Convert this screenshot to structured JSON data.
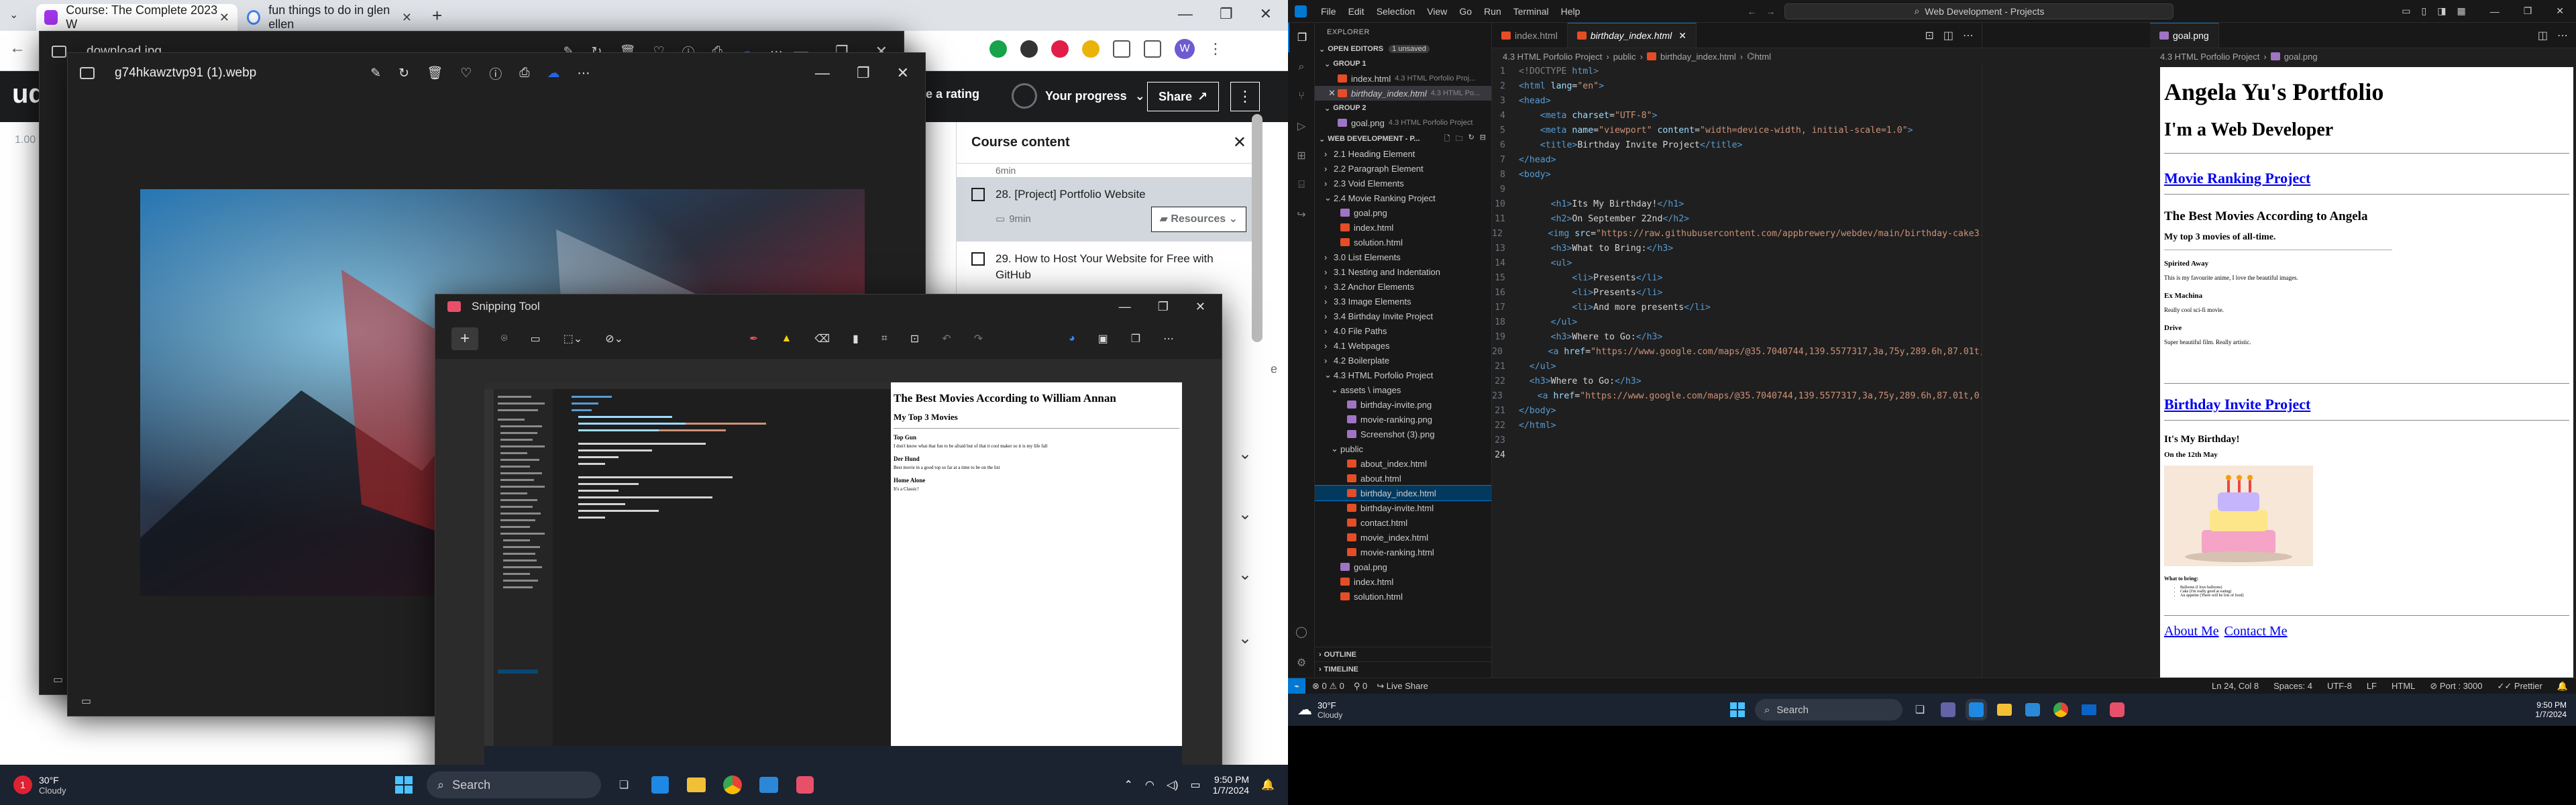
{
  "browser": {
    "tabs": [
      {
        "title": "Course: The Complete 2023 W"
      },
      {
        "title": "fun things to do in glen ellen"
      }
    ],
    "udemy": {
      "logo_fragment": "ud",
      "rating_text": "e a rating",
      "progress_label": "Your progress",
      "share_label": "Share",
      "zoom_fragment": "1.00"
    },
    "course_content": {
      "title": "Course content",
      "partial_top": "6min",
      "items": [
        {
          "title": "28. [Project] Portfolio Website",
          "duration": "9min",
          "resources": "Resources"
        },
        {
          "title": "29. How to Host Your Website for Free with GitHub",
          "duration": "",
          "resources": ""
        }
      ],
      "side_fragment": "e"
    }
  },
  "viewer_back": {
    "filename": "download.jpg"
  },
  "viewer_front": {
    "filename": "g74hkawztvp91 (1).webp"
  },
  "snipping_tool": {
    "title": "Snipping Tool",
    "mini": {
      "preview_h1": "The Best Movies According to William Annan",
      "preview_h2": "My Top 3 Movies",
      "entries": [
        {
          "title": "Top Gun",
          "desc": "I don't know what that fun to be afraid but of that it cool maker so it is my life fall"
        },
        {
          "title": "Der Hund",
          "desc": "Best movie in a good top so far at a time to be on the list"
        },
        {
          "title": "Home Alone",
          "desc": "It's a Classic!"
        }
      ]
    }
  },
  "taskbar_left": {
    "weather_temp": "30°F",
    "weather_text": "Cloudy",
    "search": "Search",
    "time": "9:50 PM",
    "date": "1/7/2024"
  },
  "vscode": {
    "menu": [
      "File",
      "Edit",
      "Selection",
      "View",
      "Go",
      "Run",
      "Terminal",
      "Help"
    ],
    "search": "Web Development - Projects",
    "explorer_title": "EXPLORER",
    "open_editors": "OPEN EDITORS",
    "unsaved": "1 unsaved",
    "group1": "GROUP 1",
    "group2": "GROUP 2",
    "open_files": [
      {
        "name": "index.html",
        "path": "4.3 HTML Porfolio Proj..."
      },
      {
        "name": "birthday_index.html",
        "path": "4.3 HTML Po..."
      },
      {
        "name": "goal.png",
        "path": "4.3 HTML Porfolio Project"
      }
    ],
    "workspace": "WEB DEVELOPMENT - P...",
    "tree": [
      {
        "label": "2.1 Heading Element",
        "kind": "folder",
        "depth": 1
      },
      {
        "label": "2.2 Paragraph Element",
        "kind": "folder",
        "depth": 1
      },
      {
        "label": "2.3 Void Elements",
        "kind": "folder",
        "depth": 1
      },
      {
        "label": "2.4 Movie Ranking Project",
        "kind": "folder-open",
        "depth": 1
      },
      {
        "label": "goal.png",
        "kind": "img",
        "depth": 2
      },
      {
        "label": "index.html",
        "kind": "html",
        "depth": 2
      },
      {
        "label": "solution.html",
        "kind": "html",
        "depth": 2
      },
      {
        "label": "3.0 List Elements",
        "kind": "folder",
        "depth": 1
      },
      {
        "label": "3.1 Nesting and Indentation",
        "kind": "folder",
        "depth": 1
      },
      {
        "label": "3.2 Anchor Elements",
        "kind": "folder",
        "depth": 1
      },
      {
        "label": "3.3 Image Elements",
        "kind": "folder",
        "depth": 1
      },
      {
        "label": "3.4 Birthday Invite Project",
        "kind": "folder",
        "depth": 1
      },
      {
        "label": "4.0 File Paths",
        "kind": "folder",
        "depth": 1
      },
      {
        "label": "4.1 Webpages",
        "kind": "folder",
        "depth": 1
      },
      {
        "label": "4.2 Boilerplate",
        "kind": "folder",
        "depth": 1
      },
      {
        "label": "4.3 HTML Porfolio Project",
        "kind": "folder-open",
        "depth": 1
      },
      {
        "label": "assets \\ images",
        "kind": "folder-open",
        "depth": 2
      },
      {
        "label": "birthday-invite.png",
        "kind": "img",
        "depth": 3
      },
      {
        "label": "movie-ranking.png",
        "kind": "img",
        "depth": 3
      },
      {
        "label": "Screenshot (3).png",
        "kind": "img",
        "depth": 3
      },
      {
        "label": "public",
        "kind": "folder-open",
        "depth": 2
      },
      {
        "label": "about_index.html",
        "kind": "html",
        "depth": 3
      },
      {
        "label": "about.html",
        "kind": "html",
        "depth": 3
      },
      {
        "label": "birthday_index.html",
        "kind": "html",
        "depth": 3,
        "selected": true
      },
      {
        "label": "birthday-invite.html",
        "kind": "html",
        "depth": 3
      },
      {
        "label": "contact.html",
        "kind": "html",
        "depth": 3
      },
      {
        "label": "movie_index.html",
        "kind": "html",
        "depth": 3
      },
      {
        "label": "movie-ranking.html",
        "kind": "html",
        "depth": 3
      },
      {
        "label": "goal.png",
        "kind": "img",
        "depth": 2
      },
      {
        "label": "index.html",
        "kind": "html",
        "depth": 2
      },
      {
        "label": "solution.html",
        "kind": "html",
        "depth": 2
      }
    ],
    "outline": "OUTLINE",
    "timeline": "TIMELINE",
    "group1_tabs": [
      {
        "label": "index.html"
      },
      {
        "label": "birthday_index.html"
      }
    ],
    "group2_tabs": [
      {
        "label": "goal.png"
      }
    ],
    "breadcrumb1": [
      "4.3 HTML Porfolio Project",
      "public",
      "birthday_index.html",
      "html"
    ],
    "breadcrumb2": [
      "4.3 HTML Porfolio Project",
      "goal.png"
    ],
    "code_lines": [
      {
        "n": "1",
        "t": [
          [
            "doc",
            "<!DOCTYPE "
          ],
          [
            "tag",
            "html"
          ],
          [
            "doc",
            ">"
          ]
        ]
      },
      {
        "n": "2",
        "t": [
          [
            "tag",
            "<html "
          ],
          [
            "attr",
            "lang"
          ],
          [
            "txt",
            "="
          ],
          [
            "str",
            "\"en\""
          ],
          [
            "tag",
            ">"
          ]
        ]
      },
      {
        "n": "3",
        "t": [
          [
            "tag",
            "<head>"
          ]
        ]
      },
      {
        "n": "4",
        "t": [
          [
            "txt",
            "    "
          ],
          [
            "tag",
            "<meta "
          ],
          [
            "attr",
            "charset"
          ],
          [
            "txt",
            "="
          ],
          [
            "str",
            "\"UTF-8\""
          ],
          [
            "tag",
            ">"
          ]
        ]
      },
      {
        "n": "5",
        "t": [
          [
            "txt",
            "    "
          ],
          [
            "tag",
            "<meta "
          ],
          [
            "attr",
            "name"
          ],
          [
            "txt",
            "="
          ],
          [
            "str",
            "\"viewport\""
          ],
          [
            "attr",
            " content"
          ],
          [
            "txt",
            "="
          ],
          [
            "str",
            "\"width=device-width, initial-scale=1.0\""
          ],
          [
            "tag",
            ">"
          ]
        ]
      },
      {
        "n": "6",
        "t": [
          [
            "txt",
            "    "
          ],
          [
            "tag",
            "<title>"
          ],
          [
            "txt",
            "Birthday Invite Project"
          ],
          [
            "tag",
            "</title>"
          ]
        ]
      },
      {
        "n": "7",
        "t": [
          [
            "tag",
            "</head>"
          ]
        ]
      },
      {
        "n": "8",
        "t": [
          [
            "tag",
            "<body>"
          ]
        ]
      },
      {
        "n": "9",
        "t": []
      },
      {
        "n": "10",
        "t": [
          [
            "txt",
            "      "
          ],
          [
            "tag",
            "<h1>"
          ],
          [
            "txt",
            "Its My Birthday!"
          ],
          [
            "tag",
            "</h1>"
          ]
        ]
      },
      {
        "n": "11",
        "t": [
          [
            "txt",
            "      "
          ],
          [
            "tag",
            "<h2>"
          ],
          [
            "txt",
            "On September 22nd"
          ],
          [
            "tag",
            "</h2>"
          ]
        ]
      },
      {
        "n": "12",
        "t": [
          [
            "txt",
            "      "
          ],
          [
            "tag",
            "<img "
          ],
          [
            "attr",
            "src"
          ],
          [
            "txt",
            "="
          ],
          [
            "str",
            "\"https://raw.githubusercontent.com/appbrewery/webdev/main/birthday-cake3.4.jpeg"
          ]
        ]
      },
      {
        "n": "13",
        "t": [
          [
            "txt",
            "      "
          ],
          [
            "tag",
            "<h3>"
          ],
          [
            "txt",
            "What to Bring:"
          ],
          [
            "tag",
            "</h3>"
          ]
        ]
      },
      {
        "n": "14",
        "t": [
          [
            "txt",
            "      "
          ],
          [
            "tag",
            "<ul>"
          ]
        ]
      },
      {
        "n": "15",
        "t": [
          [
            "txt",
            "          "
          ],
          [
            "tag",
            "<li>"
          ],
          [
            "txt",
            "Presents"
          ],
          [
            "tag",
            "</li>"
          ]
        ]
      },
      {
        "n": "16",
        "t": [
          [
            "txt",
            "          "
          ],
          [
            "tag",
            "<li>"
          ],
          [
            "txt",
            "Presents"
          ],
          [
            "tag",
            "</li>"
          ]
        ]
      },
      {
        "n": "17",
        "t": [
          [
            "txt",
            "          "
          ],
          [
            "tag",
            "<li>"
          ],
          [
            "txt",
            "And more presents"
          ],
          [
            "tag",
            "</li>"
          ]
        ]
      },
      {
        "n": "18",
        "t": [
          [
            "txt",
            "      "
          ],
          [
            "tag",
            "</ul>"
          ]
        ]
      },
      {
        "n": "19",
        "t": [
          [
            "txt",
            "      "
          ],
          [
            "tag",
            "<h3>"
          ],
          [
            "txt",
            "Where to Go:"
          ],
          [
            "tag",
            "</h3>"
          ]
        ]
      },
      {
        "n": "20",
        "t": [
          [
            "txt",
            "      "
          ],
          [
            "tag",
            "<a "
          ],
          [
            "attr",
            "href"
          ],
          [
            "txt",
            "="
          ],
          [
            "str",
            "\"https://www.google.com/maps/@35.7040744,139.5577317,3a,75y,289.6h,87.01t,0.72r/"
          ]
        ]
      },
      {
        "n": "21",
        "t": [
          [
            "txt",
            "  "
          ],
          [
            "tag",
            "</ul>"
          ]
        ]
      },
      {
        "n": "22",
        "t": [
          [
            "txt",
            "  "
          ],
          [
            "tag",
            "<h3>"
          ],
          [
            "txt",
            "Where to Go:"
          ],
          [
            "tag",
            "</h3>"
          ]
        ]
      },
      {
        "n": "23",
        "t": [
          [
            "txt",
            "    "
          ],
          [
            "tag",
            "<a "
          ],
          [
            "attr",
            "href"
          ],
          [
            "txt",
            "="
          ],
          [
            "str",
            "\"https://www.google.com/maps/@35.7040744,139.5577317,3a,75y,289.6h,87.01t,0.72r/data"
          ]
        ]
      },
      {
        "n": "21",
        "t": [
          [
            "tag",
            "</body>"
          ]
        ]
      },
      {
        "n": "22",
        "t": [
          [
            "tag",
            "</html>"
          ]
        ]
      },
      {
        "n": "23",
        "t": []
      },
      {
        "n": "24",
        "t": []
      }
    ],
    "preview": {
      "h1": "Angela Yu's Portfolio",
      "h2": "I'm a Web Developer",
      "link1": "Movie Ranking Project",
      "mtitle": "The Best Movies According to Angela",
      "msub": "My top 3 movies of all-time.",
      "movies": [
        {
          "title": "Spirited Away",
          "desc": "This is my favourite anime, I love the beautiful images."
        },
        {
          "title": "Ex Machina",
          "desc": "Really cool sci-fi movie."
        },
        {
          "title": "Drive",
          "desc": "Super beautiful film. Really artistic."
        }
      ],
      "link2": "Birthday Invite Project",
      "bday_h": "It's My Birthday!",
      "bday_sub": "On the 12th May",
      "bring": "What to bring:",
      "bring_items": [
        "Balloons (I love balloons)",
        "Cake (I'm really good at eating)",
        "An appetite (There will be lots of food)"
      ],
      "about": "About Me",
      "contact": "Contact Me"
    },
    "status": {
      "errors": "0",
      "warnings": "0",
      "ports": "0",
      "live_share": "Live Share",
      "pos": "Ln 24, Col 8",
      "spaces": "Spaces: 4",
      "enc": "UTF-8",
      "eol": "LF",
      "lang": "HTML",
      "port": "Port : 3000",
      "prettier": "Prettier"
    }
  },
  "taskbar_right": {
    "weather_temp": "30°F",
    "weather_text": "Cloudy",
    "search": "Search",
    "time": "9:50 PM",
    "date": "1/7/2024"
  },
  "colors": {
    "accent": "#0078d4",
    "udemy_dark": "#1c1d1f",
    "taskbar": "#1b2230"
  }
}
